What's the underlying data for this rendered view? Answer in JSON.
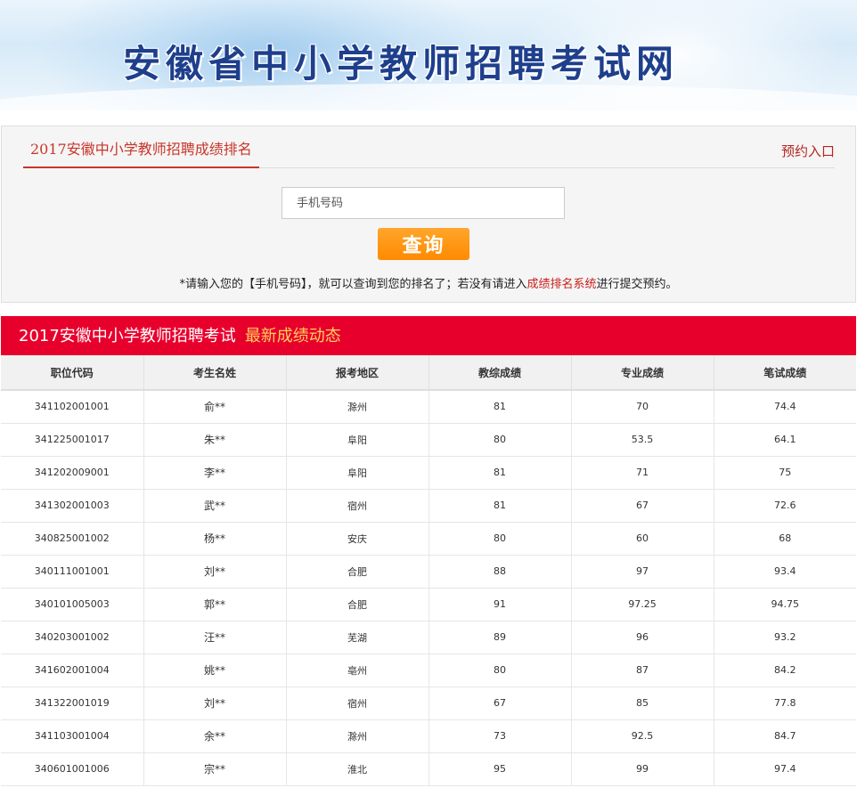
{
  "banner": {
    "title": "安徽省中小学教师招聘考试网"
  },
  "query": {
    "tab_label": "2017安徽中小学教师招聘成绩排名",
    "reserve_link": "预约入口",
    "phone_placeholder": "手机号码",
    "button_label": "查询",
    "hint_before": "*请输入您的【手机号码】，就可以查询到您的排名了；若没有请进入",
    "hint_link": "成绩排名系统",
    "hint_after": "进行提交预约。"
  },
  "results": {
    "title": "2017安徽中小学教师招聘考试",
    "subtitle": "最新成绩动态",
    "columns": [
      "职位代码",
      "考生名姓",
      "报考地区",
      "教综成绩",
      "专业成绩",
      "笔试成绩"
    ],
    "rows": [
      [
        "341102001001",
        "俞**",
        "滁州",
        "81",
        "70",
        "74.4"
      ],
      [
        "341225001017",
        "朱**",
        "阜阳",
        "80",
        "53.5",
        "64.1"
      ],
      [
        "341202009001",
        "李**",
        "阜阳",
        "81",
        "71",
        "75"
      ],
      [
        "341302001003",
        "武**",
        "宿州",
        "81",
        "67",
        "72.6"
      ],
      [
        "340825001002",
        "杨**",
        "安庆",
        "80",
        "60",
        "68"
      ],
      [
        "340111001001",
        "刘**",
        "合肥",
        "88",
        "97",
        "93.4"
      ],
      [
        "340101005003",
        "郭**",
        "合肥",
        "91",
        "97.25",
        "94.75"
      ],
      [
        "340203001002",
        "汪**",
        "芜湖",
        "89",
        "96",
        "93.2"
      ],
      [
        "341602001004",
        "姚**",
        "亳州",
        "80",
        "87",
        "84.2"
      ],
      [
        "341322001019",
        "刘**",
        "宿州",
        "67",
        "85",
        "77.8"
      ],
      [
        "341103001004",
        "余**",
        "滁州",
        "73",
        "92.5",
        "84.7"
      ],
      [
        "340601001006",
        "宗**",
        "淮北",
        "95",
        "99",
        "97.4"
      ]
    ]
  },
  "colors": {
    "banner_title": "#1e3f8c",
    "accent_red": "#e8002d",
    "button_orange": "#ff9a14",
    "subtitle_yellow": "#ffd15c"
  }
}
